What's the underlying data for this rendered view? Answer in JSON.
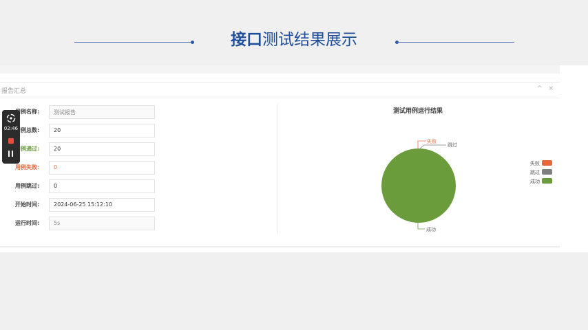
{
  "slide": {
    "title_bold": "接口",
    "title_rest": "测试结果展示"
  },
  "recorder": {
    "time": "02:46"
  },
  "panel": {
    "title": "报告汇总",
    "controls": "^ ×"
  },
  "fields": [
    {
      "label": "用例名称:",
      "value": "测试报告",
      "label_color": "#444444",
      "readonly": true
    },
    {
      "label": "用例总数:",
      "value": "20",
      "label_color": "#444444",
      "readonly": false
    },
    {
      "label": "用例通过:",
      "value": "20",
      "label_color": "#6a9c3c",
      "readonly": false
    },
    {
      "label": "用例失败:",
      "value": "0",
      "label_color": "#e8683c",
      "readonly": false
    },
    {
      "label": "用例跳过:",
      "value": "0",
      "label_color": "#444444",
      "readonly": false
    },
    {
      "label": "开始时间:",
      "value": "2024-06-25 15:12:10",
      "label_color": "#444444",
      "readonly": false
    },
    {
      "label": "运行时间:",
      "value": "5s",
      "label_color": "#444444",
      "readonly": true
    }
  ],
  "chart_data": {
    "type": "pie",
    "title": "测试用例运行结果",
    "categories": [
      "失败",
      "跳过",
      "成功"
    ],
    "values": [
      0,
      0,
      20
    ],
    "colors": [
      "#e8683c",
      "#7f7f7f",
      "#6a9c3c"
    ],
    "legend": "right"
  }
}
